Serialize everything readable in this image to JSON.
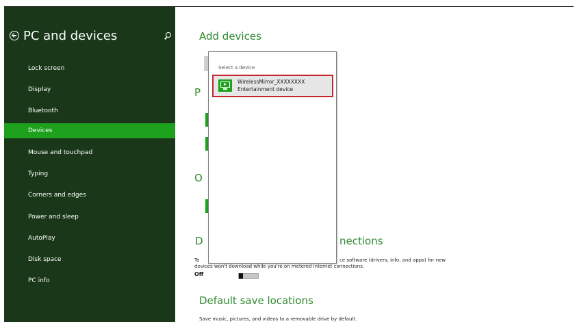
{
  "sidebar": {
    "title": "PC and devices",
    "back_icon": "back-arrow-circle-icon",
    "search_icon": "search-icon",
    "items": [
      {
        "label": "Lock screen",
        "active": false
      },
      {
        "label": "Display",
        "active": false
      },
      {
        "label": "Bluetooth",
        "active": false
      },
      {
        "label": "Devices",
        "active": true
      },
      {
        "label": "Mouse and touchpad",
        "active": false
      },
      {
        "label": "Typing",
        "active": false
      },
      {
        "label": "Corners and edges",
        "active": false
      },
      {
        "label": "Power and sleep",
        "active": false
      },
      {
        "label": "AutoPlay",
        "active": false
      },
      {
        "label": "Disk space",
        "active": false
      },
      {
        "label": "PC info",
        "active": false
      }
    ]
  },
  "main": {
    "add_devices_heading": "Add devices",
    "partial_p": "P",
    "partial_o": "O",
    "partial_d": "D",
    "metered_heading_tail": "nections",
    "metered_desc_line1_start": "To",
    "metered_desc_line1_end": "ce software (drivers, info, and apps) for new",
    "metered_desc_line2": "devices won't download while you're on metered internet connections.",
    "metered_toggle_state": "Off",
    "default_save_heading": "Default save locations",
    "default_save_desc": "Save music, pictures, and videos to a removable drive by default."
  },
  "popup": {
    "title": "Select a device",
    "device": {
      "name": "WirelessMirror_XXXXXXXX",
      "type": "Entertainment device",
      "icon": "display-device-icon"
    }
  },
  "colors": {
    "sidebar_bg": "#1a3819",
    "accent_green": "#1ea21e",
    "heading_green": "#2e8a2e",
    "highlight_border": "#c4262e"
  }
}
